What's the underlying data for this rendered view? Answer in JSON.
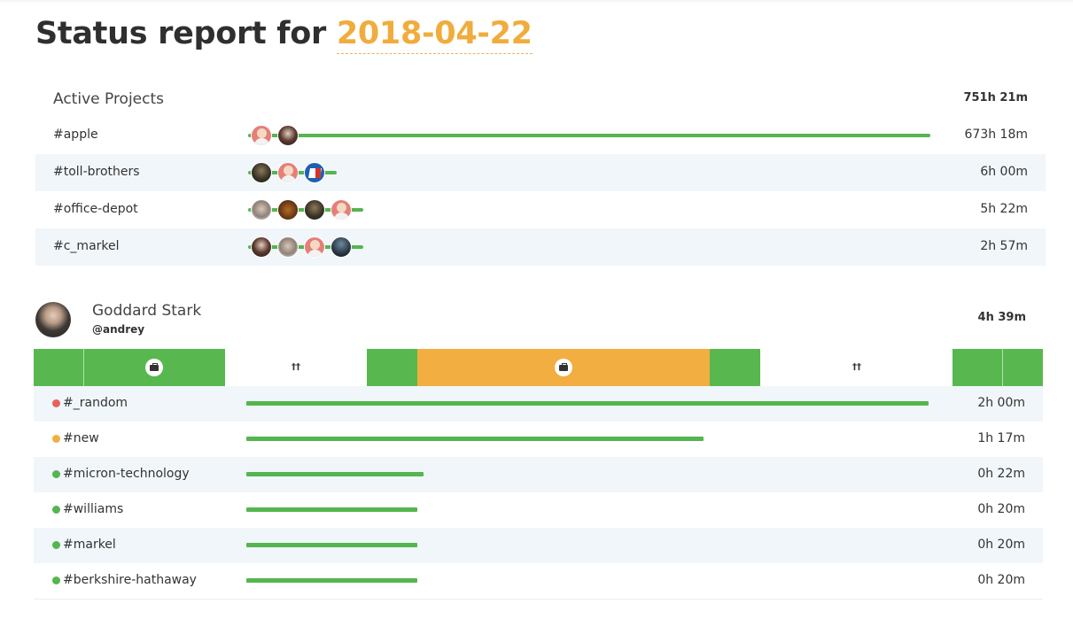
{
  "report": {
    "title_prefix": "Status report for",
    "date": "2018-04-22"
  },
  "active_projects": {
    "label": "Active Projects",
    "total": "751h 21m",
    "rows": [
      {
        "name": "#apple",
        "time": "673h 18m",
        "bar_fraction": 1.0,
        "avatars": [
          "pink",
          "woman"
        ]
      },
      {
        "name": "#toll-brothers",
        "time": "6h 00m",
        "bar_fraction": 0.11,
        "avatars": [
          "dark",
          "pink",
          "blue"
        ]
      },
      {
        "name": "#office-depot",
        "time": "5h 22m",
        "bar_fraction": 0.1,
        "avatars": [
          "light",
          "brown",
          "dark",
          "pink"
        ]
      },
      {
        "name": "#c_markel",
        "time": "2h 57m",
        "bar_fraction": 0.1,
        "avatars": [
          "woman",
          "light",
          "pink",
          "dark2"
        ]
      }
    ]
  },
  "user": {
    "name": "Goddard Stark",
    "handle": "@andrey",
    "total": "4h 39m",
    "timeline": [
      {
        "type": "work",
        "dividers": [
          0.26
        ],
        "icon": "briefcase-icon"
      },
      {
        "type": "break",
        "icon": "fork-knife-icon"
      },
      {
        "type": "work"
      },
      {
        "type": "meet",
        "icon": "briefcase-icon"
      },
      {
        "type": "work"
      },
      {
        "type": "break",
        "icon": "fork-knife-icon"
      },
      {
        "type": "work",
        "dividers": [
          0.55
        ]
      }
    ],
    "tasks": [
      {
        "name": "#_random",
        "time": "2h 00m",
        "dot_color": "#e9605a",
        "bar_fraction": 1.0
      },
      {
        "name": "#new",
        "time": "1h 17m",
        "dot_color": "#f2ae40",
        "bar_fraction": 0.67
      },
      {
        "name": "#micron-technology",
        "time": "0h 22m",
        "dot_color": "#55b54f",
        "bar_fraction": 0.26
      },
      {
        "name": "#williams",
        "time": "0h 20m",
        "dot_color": "#55b54f",
        "bar_fraction": 0.25
      },
      {
        "name": "#markel",
        "time": "0h 20m",
        "dot_color": "#55b54f",
        "bar_fraction": 0.25
      },
      {
        "name": "#berkshire-hathaway",
        "time": "0h 20m",
        "dot_color": "#55b54f",
        "bar_fraction": 0.25
      }
    ]
  },
  "colors": {
    "accent": "#f0ac3d",
    "work": "#58b84f",
    "meeting": "#f2ae40",
    "row_alt": "#f1f6fa"
  }
}
